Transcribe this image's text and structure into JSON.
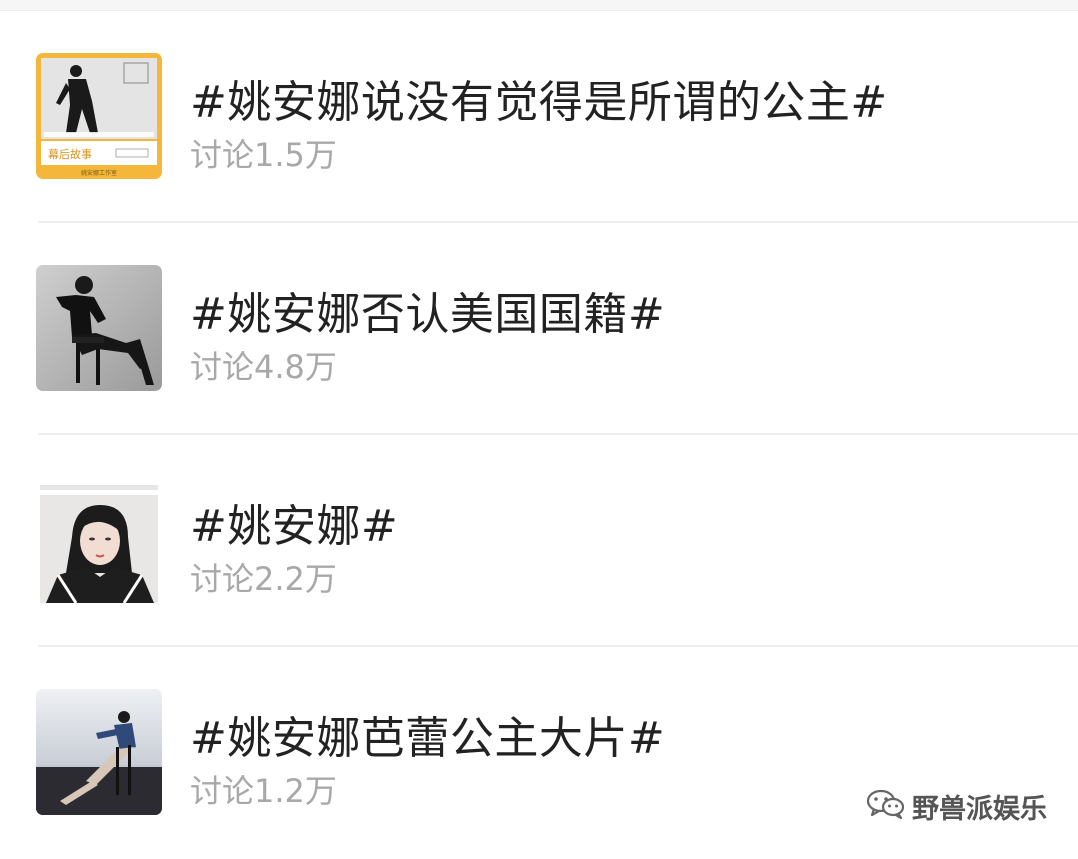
{
  "topics": [
    {
      "title": "#姚安娜说没有觉得是所谓的公主#",
      "meta": "讨论1.5万",
      "thumb_caption": "幕后故事",
      "thumb_footer": "姚安娜工作室"
    },
    {
      "title": "#姚安娜否认美国国籍#",
      "meta": "讨论4.8万"
    },
    {
      "title": "#姚安娜#",
      "meta": "讨论2.2万"
    },
    {
      "title": "#姚安娜芭蕾公主大片#",
      "meta": "讨论1.2万"
    }
  ],
  "watermark": {
    "text": "野兽派娱乐",
    "icon": "wechat-icon"
  },
  "colors": {
    "title_text": "#222222",
    "meta_text": "#a8a8a8",
    "divider": "#eeeeee",
    "thumb_border_accent": "#f5b73b"
  }
}
